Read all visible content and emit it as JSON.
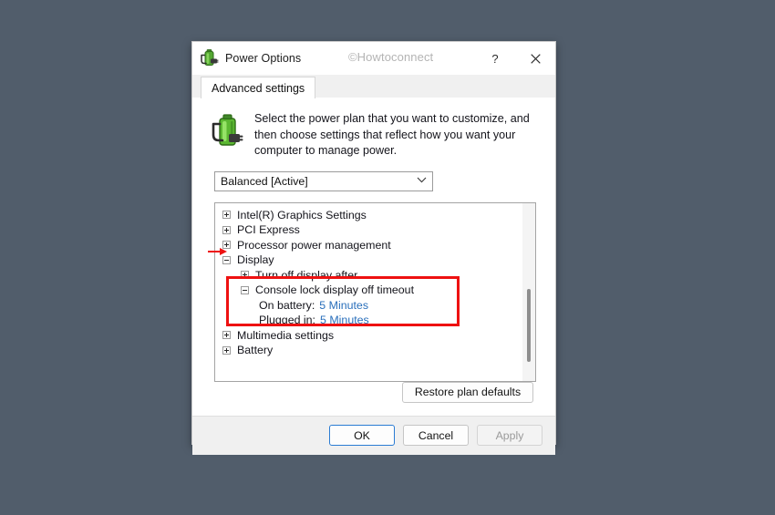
{
  "window": {
    "title": "Power Options",
    "icon": "power-plug-battery-icon",
    "watermark": "©Howtoconnect",
    "help_label": "?",
    "close_label": "✕"
  },
  "tabs": [
    {
      "label": "Advanced settings",
      "active": true
    }
  ],
  "intro": {
    "icon": "power-plug-battery-icon",
    "text": "Select the power plan that you want to customize, and then choose settings that reflect how you want your computer to manage power."
  },
  "plan_select": {
    "value": "Balanced [Active]",
    "chevron": "∨",
    "options": [
      "Balanced [Active]"
    ]
  },
  "tree": {
    "nodes": [
      {
        "label": "Intel(R) Graphics Settings",
        "state": "collapsed",
        "level": 0
      },
      {
        "label": "PCI Express",
        "state": "collapsed",
        "level": 0
      },
      {
        "label": "Processor power management",
        "state": "collapsed",
        "level": 0
      },
      {
        "label": "Display",
        "state": "expanded",
        "level": 0,
        "pointed": true
      },
      {
        "label": "Turn off display after",
        "state": "collapsed",
        "level": 1
      },
      {
        "label": "Console lock display off timeout",
        "state": "expanded",
        "level": 1,
        "highlighted": true
      },
      {
        "label": "On battery:",
        "value": "5 Minutes",
        "state": "value",
        "level": 2,
        "highlighted": true
      },
      {
        "label": "Plugged in:",
        "value": "5 Minutes",
        "state": "value",
        "level": 2,
        "highlighted": true
      },
      {
        "label": "Multimedia settings",
        "state": "collapsed",
        "level": 0
      },
      {
        "label": "Battery",
        "state": "collapsed",
        "level": 0
      }
    ]
  },
  "buttons": {
    "restore": "Restore plan defaults",
    "ok": "OK",
    "cancel": "Cancel",
    "apply": "Apply"
  },
  "colors": {
    "desktop_background": "#515d6b",
    "link_blue": "#2a6fbb",
    "highlight_red": "#ee1111",
    "accent_blue": "#2b7cd3",
    "watermark_gray": "#b4b4b4"
  }
}
